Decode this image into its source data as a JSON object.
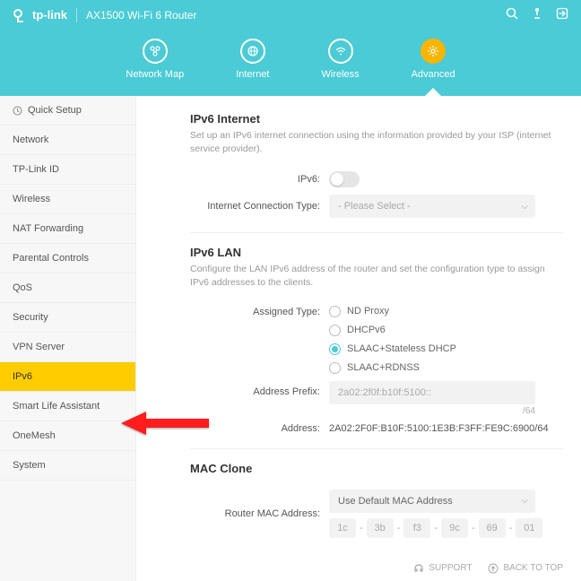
{
  "brand": "tp-link",
  "product": "AX1500 Wi-Fi 6 Router",
  "nav": {
    "network_map": "Network Map",
    "internet": "Internet",
    "wireless": "Wireless",
    "advanced": "Advanced"
  },
  "sidebar": {
    "quick_setup": "Quick Setup",
    "network": "Network",
    "tplink_id": "TP-Link ID",
    "wireless": "Wireless",
    "nat_forwarding": "NAT Forwarding",
    "parental": "Parental Controls",
    "qos": "QoS",
    "security": "Security",
    "vpn": "VPN Server",
    "ipv6": "IPv6",
    "smartlife": "Smart Life Assistant",
    "onemesh": "OneMesh",
    "system": "System"
  },
  "ipv6_internet": {
    "title": "IPv6 Internet",
    "desc": "Set up an IPv6 internet connection using the information provided by your ISP (internet service provider).",
    "ipv6_label": "IPv6:",
    "conn_type_label": "Internet Connection Type:",
    "conn_type_placeholder": "- Please Select -"
  },
  "ipv6_lan": {
    "title": "IPv6 LAN",
    "desc": "Configure the LAN IPv6 address of the router and set the configuration type to assign IPv6 addresses to the clients.",
    "assigned_type_label": "Assigned Type:",
    "radio_nd": "ND Proxy",
    "radio_dhcp": "DHCPv6",
    "radio_slaac_dhcp": "SLAAC+Stateless DHCP",
    "radio_slaac_rdnss": "SLAAC+RDNSS",
    "address_prefix_label": "Address Prefix:",
    "address_prefix_value": "2a02:2f0f:b10f:5100::",
    "prefix_len": "/64",
    "address_label": "Address:",
    "address_value": "2A02:2F0F:B10F:5100:1E3B:F3FF:FE9C:6900/64"
  },
  "mac_clone": {
    "title": "MAC Clone",
    "router_mac_label": "Router MAC Address:",
    "router_mac_value": "Use Default MAC Address",
    "segs": [
      "1c",
      "3b",
      "f3",
      "9c",
      "69",
      "01"
    ]
  },
  "footer": {
    "support": "SUPPORT",
    "backtotop": "BACK TO TOP"
  }
}
